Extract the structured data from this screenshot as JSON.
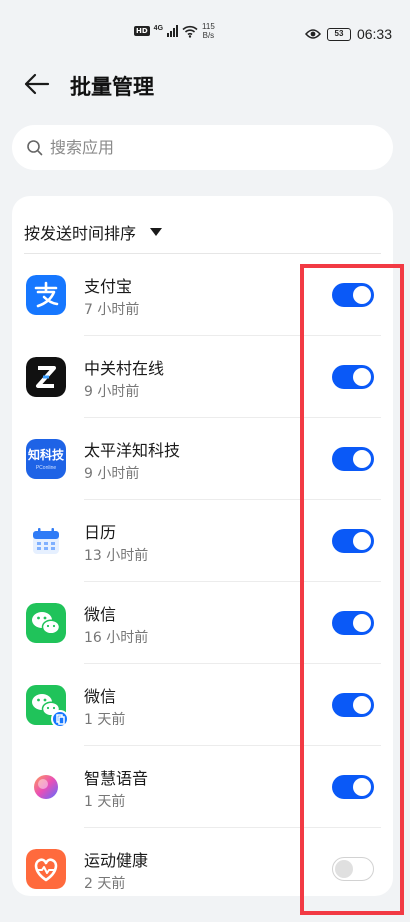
{
  "status_bar": {
    "hd_badge": "HD",
    "network": "4G",
    "speed_value": "115",
    "speed_unit": "B/s",
    "battery": "53",
    "time": "06:33"
  },
  "header": {
    "title": "批量管理"
  },
  "search": {
    "placeholder": "搜索应用"
  },
  "sort": {
    "label": "按发送时间排序"
  },
  "apps": [
    {
      "name": "支付宝",
      "time": "7 小时前",
      "enabled": true,
      "icon": "alipay-icon"
    },
    {
      "name": "中关村在线",
      "time": "9 小时前",
      "enabled": true,
      "icon": "zol-icon"
    },
    {
      "name": "太平洋知科技",
      "time": "9 小时前",
      "enabled": true,
      "icon": "pconline-icon",
      "icon_text": "知科技",
      "icon_subtext": "PConline"
    },
    {
      "name": "日历",
      "time": "13 小时前",
      "enabled": true,
      "icon": "calendar-icon"
    },
    {
      "name": "微信",
      "time": "16 小时前",
      "enabled": true,
      "icon": "wechat-icon"
    },
    {
      "name": "微信",
      "time": "1 天前",
      "enabled": true,
      "icon": "wechat-clone-icon"
    },
    {
      "name": "智慧语音",
      "time": "1 天前",
      "enabled": true,
      "icon": "voice-assistant-icon"
    },
    {
      "name": "运动健康",
      "time": "2 天前",
      "enabled": false,
      "icon": "health-icon"
    }
  ],
  "colors": {
    "toggle_on": "#0a59f7",
    "highlight": "#f23a44",
    "background": "#f1f3f5"
  }
}
